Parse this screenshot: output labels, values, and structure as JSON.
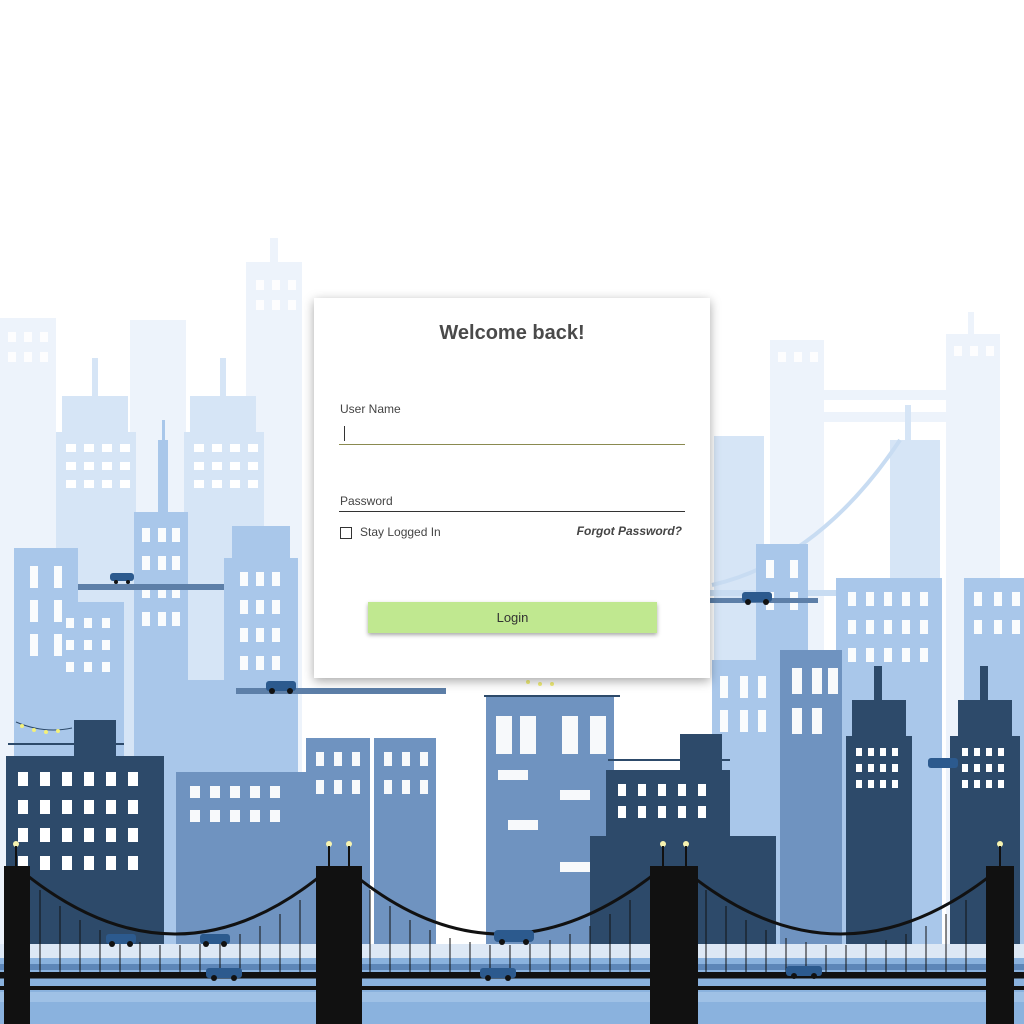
{
  "login": {
    "title": "Welcome back!",
    "username_label": "User Name",
    "username_value": "",
    "password_label": "Password",
    "password_value": "",
    "stay_logged_in_label": "Stay Logged In",
    "stay_logged_in_checked": false,
    "forgot_password_label": "Forgot Password?",
    "login_button_label": "Login"
  },
  "colors": {
    "button_bg": "#c0e890",
    "active_underline": "#8a8a50",
    "inactive_underline": "#333333",
    "sky_far": "#e6effa",
    "building_mid": "#8fb3df",
    "building_dark": "#2d4a6a",
    "bridge": "#111111",
    "water": "#8ab2de"
  },
  "icons": {
    "background": "city-skyline-illustration",
    "checkbox": "checkbox-icon"
  }
}
